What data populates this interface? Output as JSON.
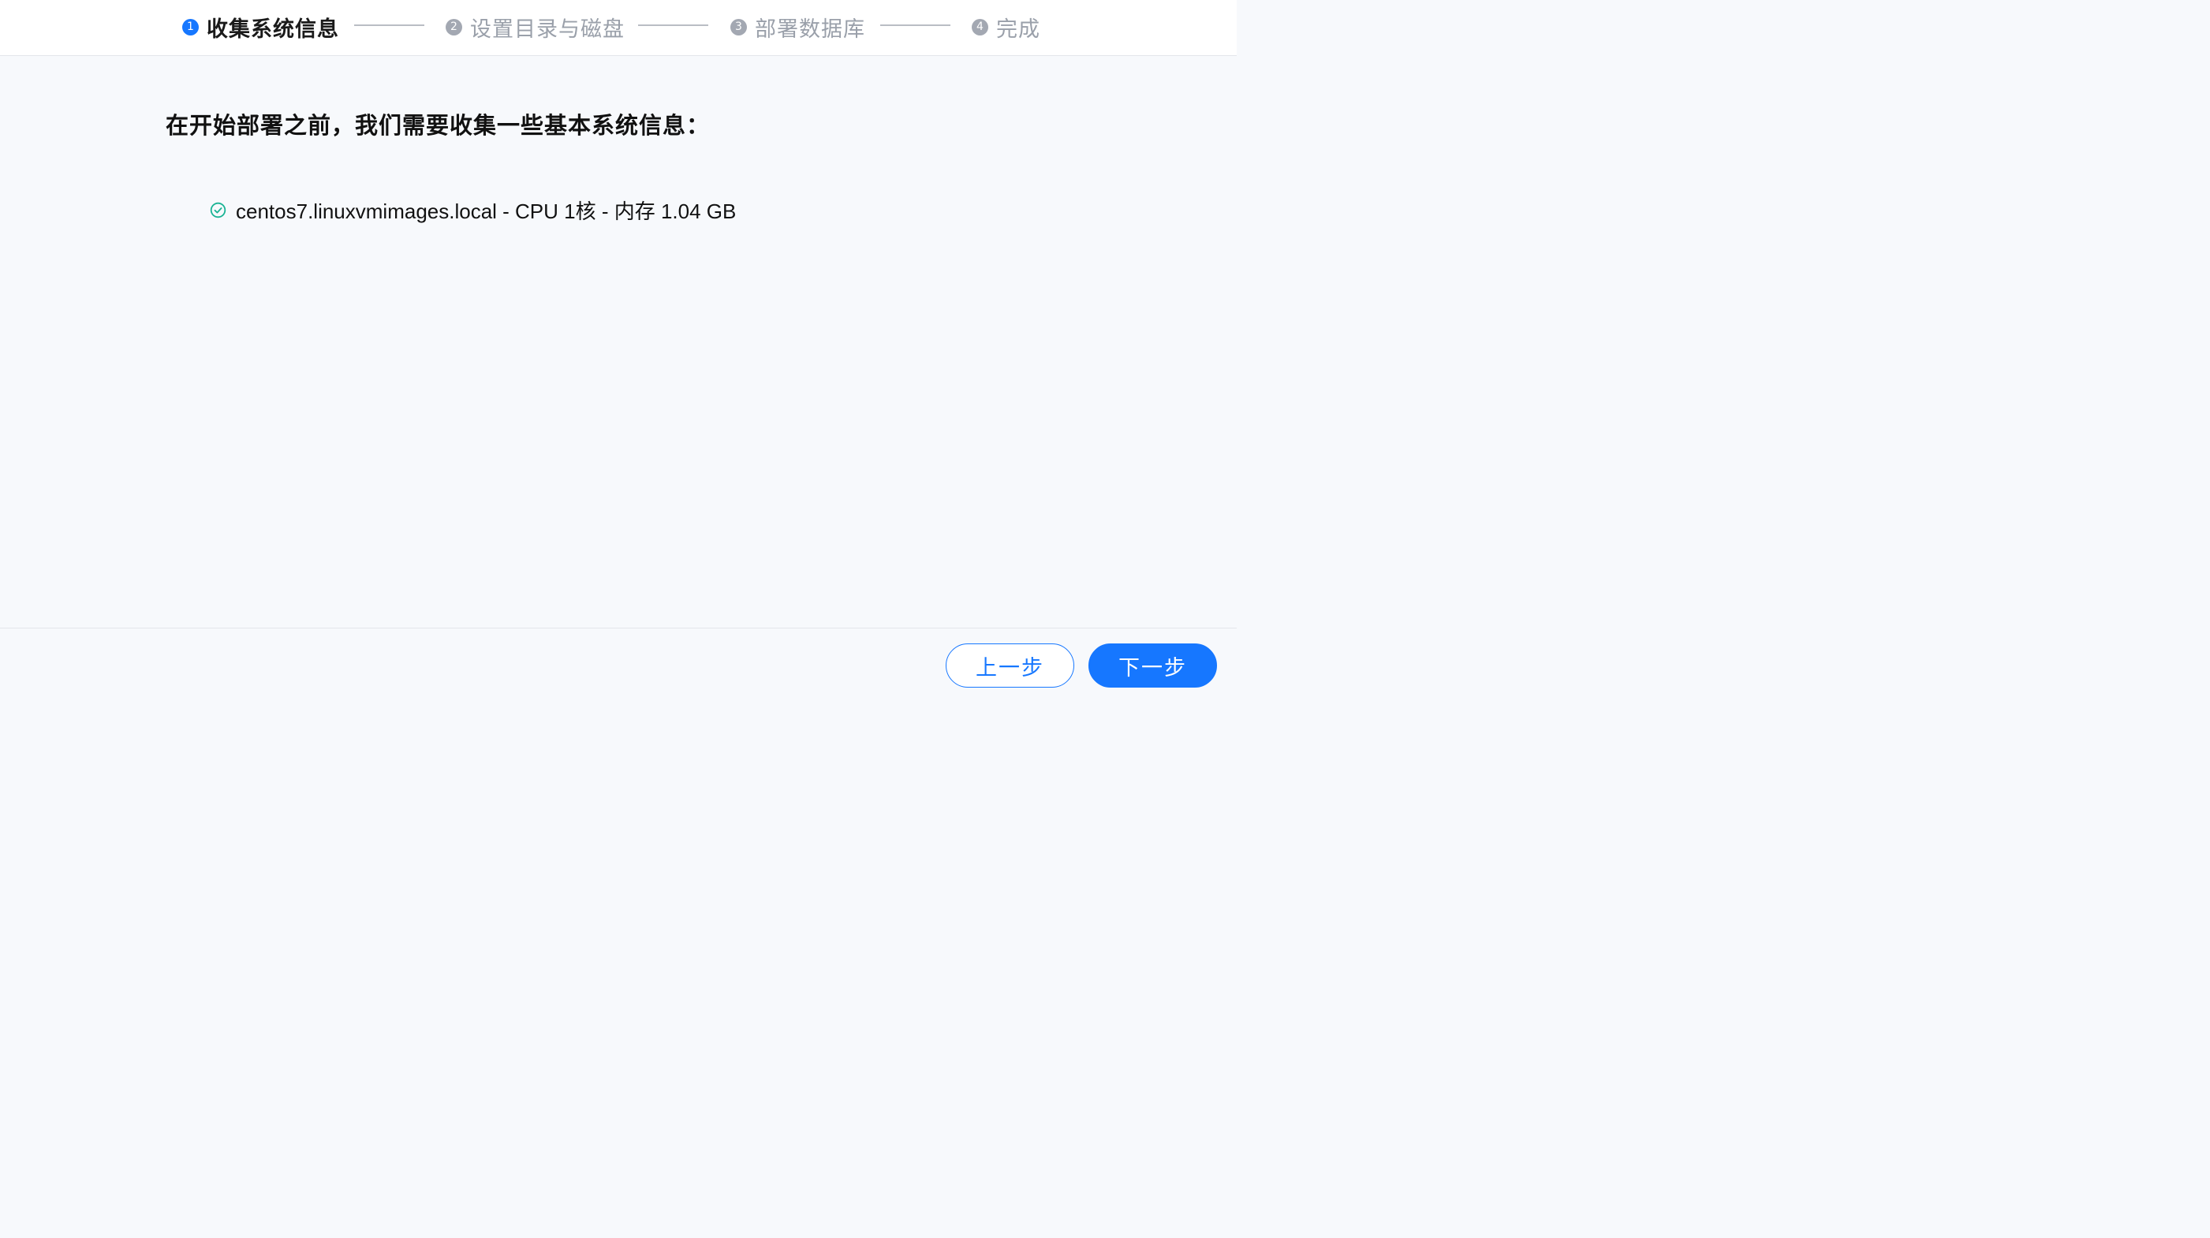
{
  "stepper": {
    "steps": [
      {
        "number": "1",
        "label": "收集系统信息"
      },
      {
        "number": "2",
        "label": "设置目录与磁盘"
      },
      {
        "number": "3",
        "label": "部署数据库"
      },
      {
        "number": "4",
        "label": "完成"
      }
    ],
    "active_step": "1"
  },
  "main": {
    "heading": "在开始部署之前，我们需要收集一些基本系统信息：",
    "system_info": {
      "status_icon": "check-circle-icon",
      "text": "centos7.linuxvmimages.local - CPU 1核 - 内存 1.04 GB"
    }
  },
  "footer": {
    "prev_label": "上一步",
    "next_label": "下一步"
  },
  "colors": {
    "accent": "#1677ff",
    "success": "#19b394",
    "inactive": "#9aa0aa"
  }
}
